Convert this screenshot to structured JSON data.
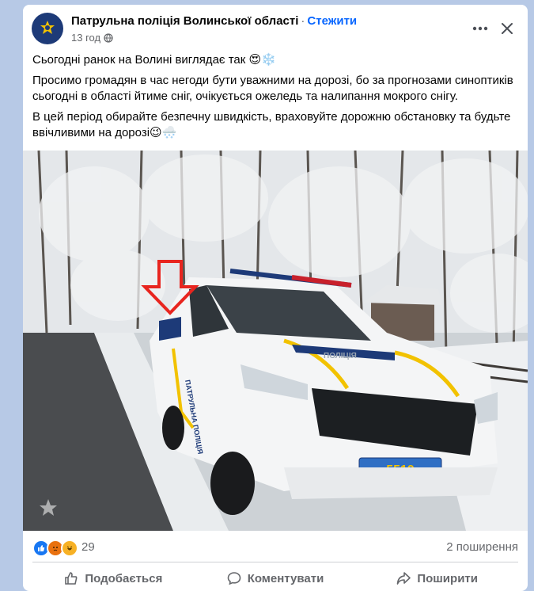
{
  "post": {
    "page_name": "Патрульна поліція Волинської області",
    "separator": "·",
    "follow_label": "Стежити",
    "time": "13 год",
    "paragraphs": [
      "Сьогодні ранок на Волині виглядає так 😍❄️",
      "Просимо громадян в час негоди бути уважними на дорозі, бо за прогнозами синоптиків сьогодні в області йтиме сніг, очікується ожеледь та налипання мокрого снігу.",
      "В цей період обирайте безпечну швидкість, враховуйте дорожню обстановку та будьте ввічливими на дорозі😉🌨️"
    ],
    "photo": {
      "vehicle_side_text": "ПАТРУЛЬНА ПОЛІЦІЯ",
      "hood_text": "ПОЛІЦІЯ",
      "plate": "5519",
      "arrow_color": "#e8251f"
    },
    "reactions_count": "29",
    "shares": "2 поширення",
    "actions": {
      "like": "Подобається",
      "comment": "Коментувати",
      "share": "Поширити"
    }
  },
  "colors": {
    "background": "#b7c9e6",
    "card": "#ffffff",
    "link": "#0866ff",
    "secondary_text": "#65676b",
    "police_blue": "#1d3a78",
    "police_yellow": "#f2c200"
  }
}
